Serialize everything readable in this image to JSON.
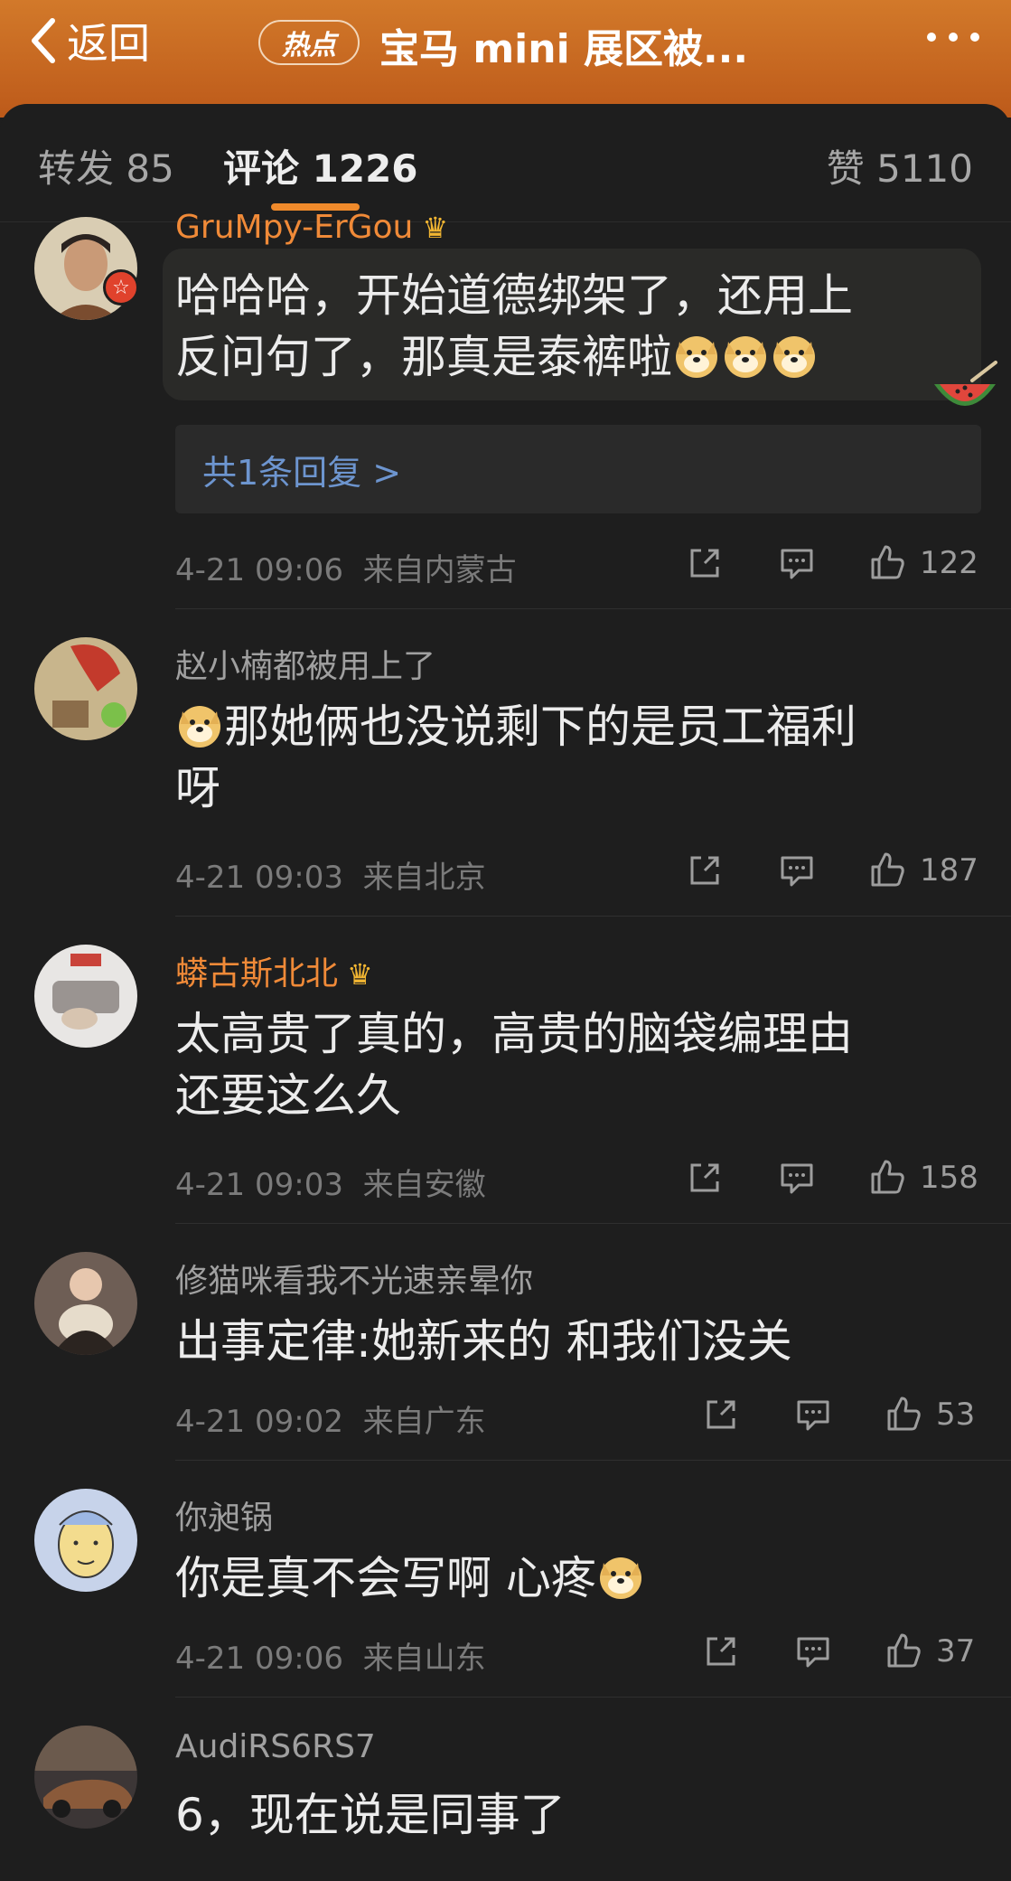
{
  "header": {
    "back_label": "返回",
    "hot_badge": "热点",
    "title": "宝马 mini 展区被..."
  },
  "tabs": {
    "repost": "转发 85",
    "comments": "评论 1226",
    "likes": "赞 5110"
  },
  "comments": [
    {
      "user": "GruMpy-ErGou",
      "name_color": "#f08a38",
      "text_lines": [
        "哈哈哈，开始道德绑架了，还用上",
        "反问句了，那真是泰裤啦"
      ],
      "emoji": "doge-emoji",
      "replies_label": "共1条回复 >",
      "time": "4-21 09:06",
      "location": "来自内蒙古",
      "likes": "122"
    },
    {
      "user": "赵小楠都被用上了",
      "name_color": "#a0a0a0",
      "text_lines": [
        "那她俩也没说剩下的是员工福利",
        "呀"
      ],
      "emoji": "doge-emoji",
      "time": "4-21 09:03",
      "location": "来自北京",
      "likes": "187"
    },
    {
      "user": "蟒古斯北北",
      "name_color": "#f08a38",
      "text_lines": [
        "太高贵了真的，高贵的脑袋编理由",
        "还要这么久"
      ],
      "time": "4-21 09:03",
      "location": "来自安徽",
      "likes": "158"
    },
    {
      "user": "修猫咪看我不光速亲晕你",
      "name_color": "#a0a0a0",
      "text_lines": [
        "出事定律:她新来的 和我们没关"
      ],
      "time": "4-21 09:02",
      "location": "来自广东",
      "likes": "53"
    },
    {
      "user": "你昶锅",
      "name_color": "#a0a0a0",
      "text_lines": [
        "你是真不会写啊 心疼"
      ],
      "emoji": "doge-emoji",
      "time": "4-21 09:06",
      "location": "来自山东",
      "likes": "37"
    },
    {
      "user": "AudiRS6RS7",
      "name_color": "#a0a0a0",
      "text_lines": [
        "6，现在说是同事了"
      ]
    }
  ]
}
